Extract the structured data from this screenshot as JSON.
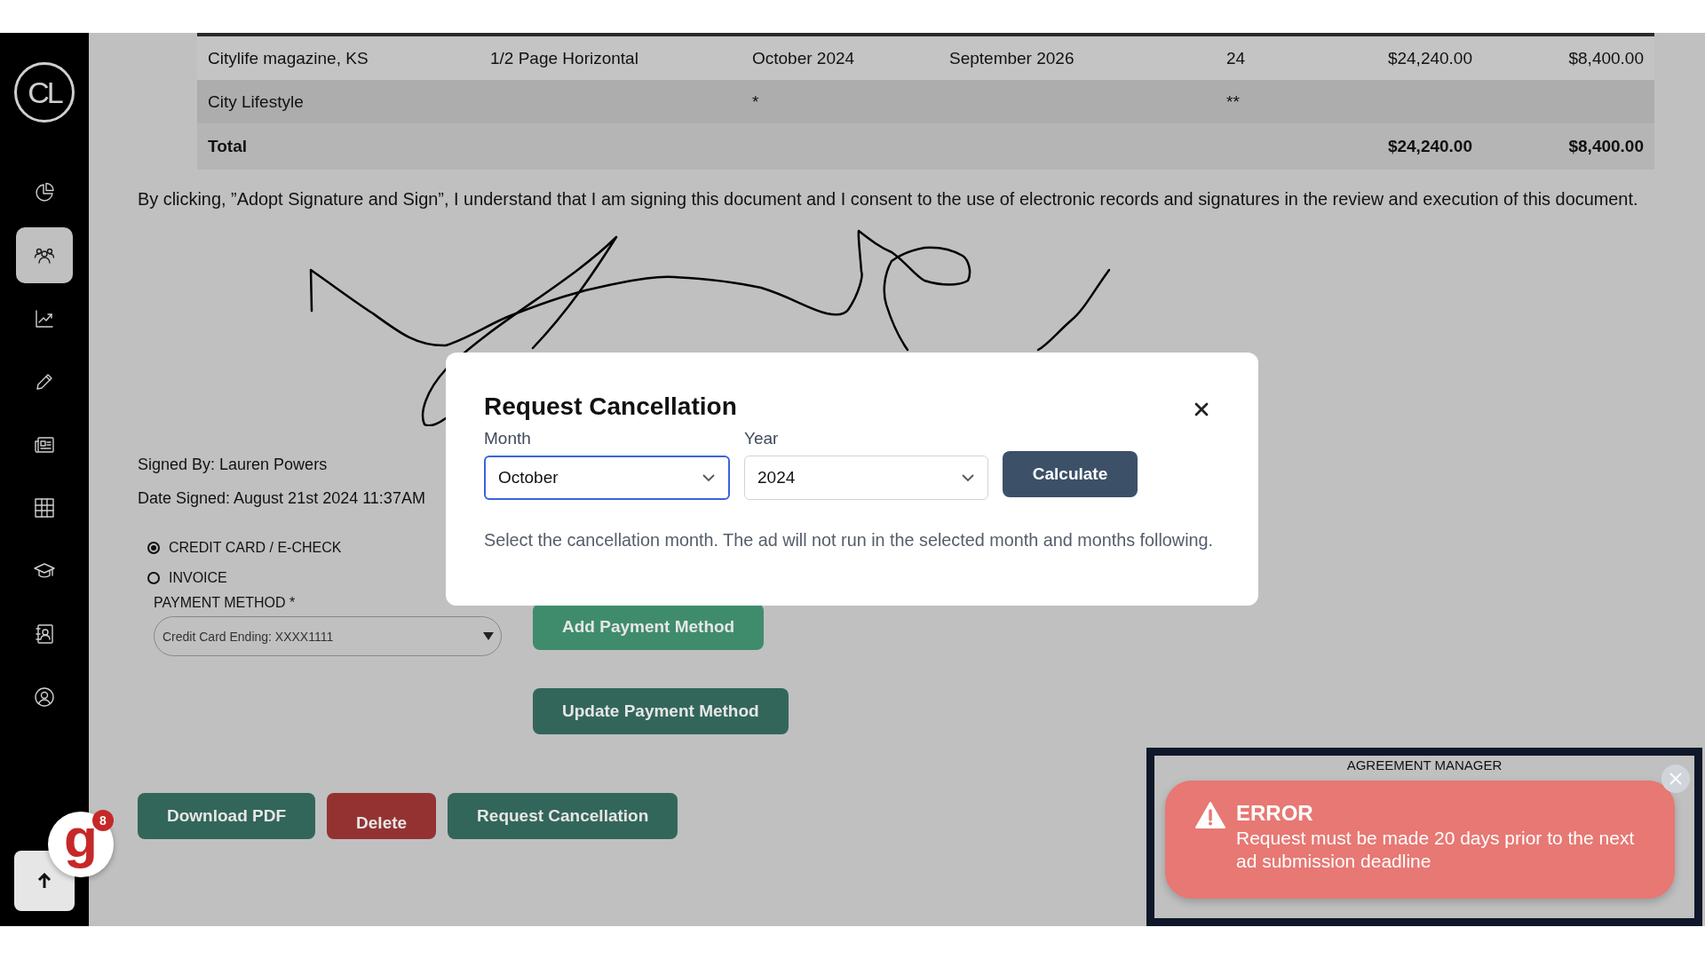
{
  "sidebar": {
    "logo": "CL",
    "items": [
      {
        "kind": "pie",
        "selected": false
      },
      {
        "kind": "people",
        "selected": true
      },
      {
        "kind": "trend",
        "selected": false
      },
      {
        "kind": "pencil",
        "selected": false
      },
      {
        "kind": "news",
        "selected": false
      },
      {
        "kind": "grid",
        "selected": false
      },
      {
        "kind": "cap",
        "selected": false
      },
      {
        "kind": "contacts",
        "selected": false
      },
      {
        "kind": "user",
        "selected": false
      }
    ]
  },
  "table": {
    "rows": [
      {
        "kind": "data",
        "column_1": "Citylife magazine, KS",
        "column_2": "1/2 Page Horizontal",
        "column_3": "October 2024",
        "column_4": "September 2026",
        "column_5": "24",
        "column_6": "$24,240.00",
        "column_7": "$8,400.00"
      },
      {
        "kind": "data",
        "column_1": "City Lifestyle",
        "column_3": "*",
        "column_5": "**"
      },
      {
        "kind": "total",
        "column_1": "Total",
        "column_6": "$24,240.00",
        "column_7": "$8,400.00"
      }
    ]
  },
  "consent_text": "By clicking, ”Adopt Signature and Sign”, I understand that I am signing this document and I consent to the use of electronic records and signatures in the review and execution of this document.",
  "signed_by": "Signed By: Lauren Powers",
  "date_signed": "Date Signed: August 21st 2024 11:37AM",
  "payment_options": [
    {
      "label": "CREDIT CARD / E-CHECK",
      "selected": true
    },
    {
      "label": "INVOICE",
      "selected": false
    }
  ],
  "payment_method": {
    "label": "PAYMENT METHOD *",
    "value": "Credit Card Ending: XXXX1111"
  },
  "payment_buttons": [
    {
      "label": "Add Payment Method",
      "kind": "light"
    },
    {
      "label": "Update Payment Method",
      "kind": "dark"
    }
  ],
  "actions": [
    {
      "label": "Download PDF",
      "kind": "primary"
    },
    {
      "label": "Delete",
      "kind": "danger"
    },
    {
      "label": "Request Cancellation",
      "kind": "primary"
    }
  ],
  "assistant_badge": {
    "letter": "g",
    "count": "8"
  },
  "modal": {
    "title": "Request Cancellation",
    "month": {
      "label": "Month",
      "value": "October",
      "focused": true
    },
    "year": {
      "label": "Year",
      "value": "2024",
      "focused": false
    },
    "button": "Calculate",
    "description": "Select the cancellation month. The ad will not run in the selected month and months following."
  },
  "toast_panel": {
    "title": "AGREEMENT MANAGER"
  },
  "toast": {
    "title": "ERROR",
    "message": "Request must be made 20 days prior to the next ad submission deadline"
  }
}
